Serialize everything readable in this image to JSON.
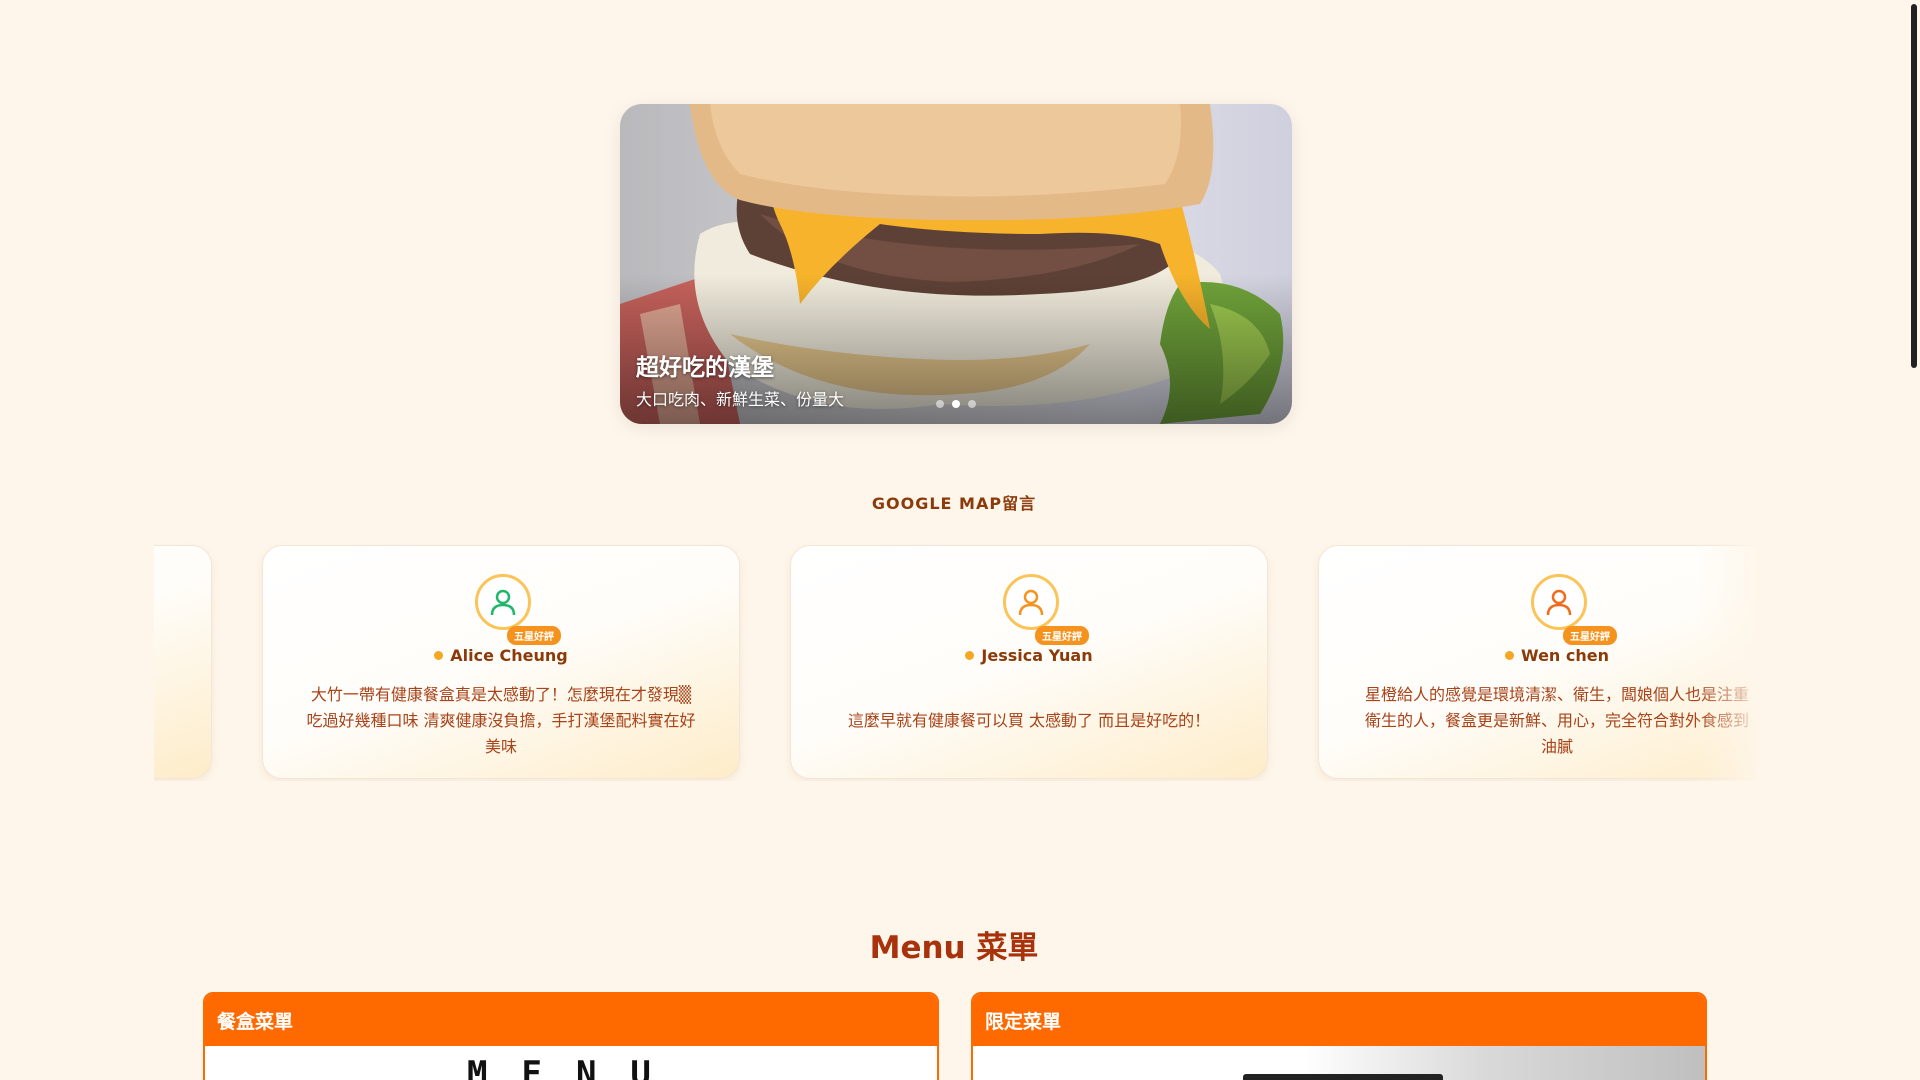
{
  "hero": {
    "title": "超好吃的漢堡",
    "subtitle": "大口吃肉、新鮮生菜、份量大",
    "slides": 3,
    "active_slide": 2
  },
  "reviews": {
    "section_label": "GOOGLE MAP留言",
    "items": [
      {
        "name": "Alice Cheung",
        "badge": "五星好評",
        "text": "大竹一帶有健康餐盒真是太感動了！怎麼現在才發現▒吃過好幾種口味 清爽健康沒負擔，手打漢堡配料實在好美味",
        "avatar_color": "#1fb86b"
      },
      {
        "name": "Jessica Yuan",
        "badge": "五星好評",
        "text": "這麼早就有健康餐可以買 太感動了 而且是好吃的！",
        "avatar_color": "#f6931e"
      },
      {
        "name": "Wen chen",
        "badge": "五星好評",
        "text": "星橙給人的感覺是環境清潔、衛生，闆娘個人也是注重衛生的人，餐盒更是新鮮、用心，完全符合對外食感到油膩",
        "avatar_color": "#f26b1d"
      }
    ]
  },
  "menu": {
    "title": "Menu 菜單",
    "cards": [
      {
        "label": "餐盒菜單",
        "image_text": "MENU"
      },
      {
        "label": "限定菜單",
        "image_text": ""
      }
    ]
  },
  "colors": {
    "background": "#fef6ea",
    "accent": "#ff6a00",
    "text_brown": "#8b3a0a"
  }
}
